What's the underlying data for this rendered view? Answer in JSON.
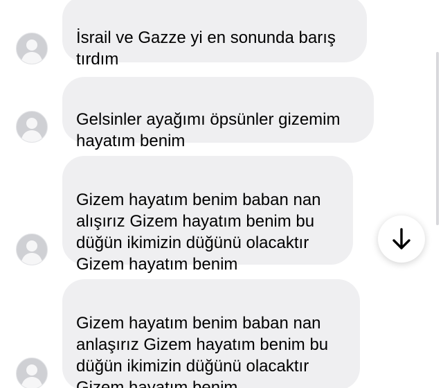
{
  "messages": [
    {
      "text": "İsrail ve Gazze yi en sonunda barış\ntırdım"
    },
    {
      "text": "Gelsinler ayağımı öpsünler gizemim\nhayatım benim"
    },
    {
      "text": "Gizem hayatım benim baban nan\nalışırız  Gizem hayatım benim bu\ndüğün ikimizin düğünü olacaktır\nGizem hayatım benim"
    },
    {
      "text": "Gizem hayatım benim baban nan\nanlaşırız Gizem hayatım benim bu\ndüğün ikimizin düğünü olacaktır\nGizem hayatım benim"
    }
  ],
  "icons": {
    "avatar": "default-user-avatar-icon",
    "scroll_down": "arrow-down-icon"
  },
  "colors": {
    "bubble": "#efeff1",
    "avatar": "#cfd0d4",
    "text": "#000000"
  }
}
